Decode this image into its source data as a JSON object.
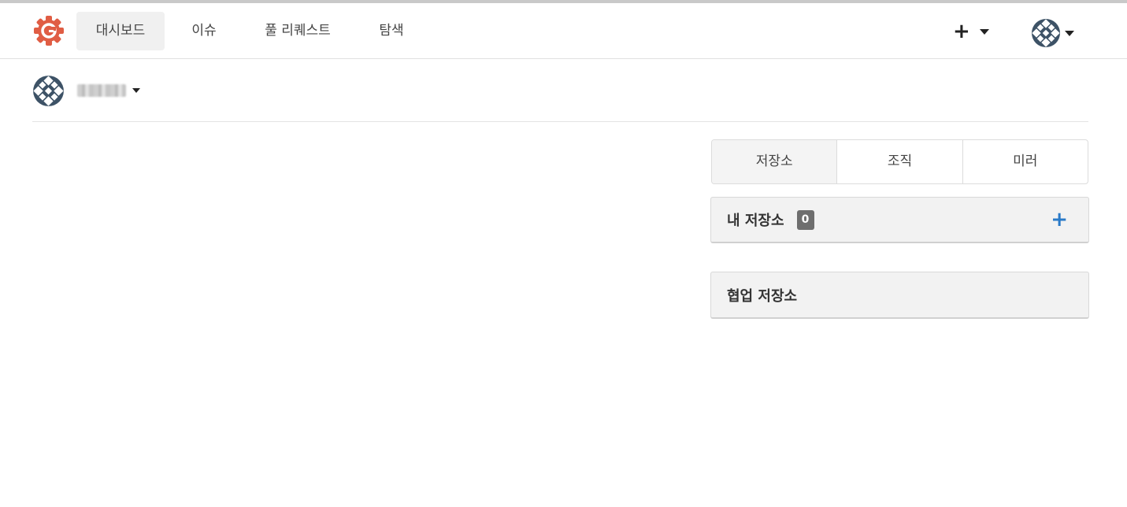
{
  "navbar": {
    "logo_icon": "gitea-gear-logo-icon",
    "brand_color": "#e05d44",
    "items": [
      {
        "label": "대시보드",
        "active": true
      },
      {
        "label": "이슈",
        "active": false
      },
      {
        "label": "풀 리퀘스트",
        "active": false
      },
      {
        "label": "탐색",
        "active": false
      }
    ],
    "create_label": "+",
    "user_avatar_icon": "avatar-icon"
  },
  "context": {
    "avatar_icon": "avatar-icon",
    "name": "user"
  },
  "tabs": [
    {
      "label": "저장소",
      "active": true
    },
    {
      "label": "조직",
      "active": false
    },
    {
      "label": "미러",
      "active": false
    }
  ],
  "my_repos": {
    "title": "내 저장소",
    "count": "0",
    "add_label": "+",
    "accent": "#2a7ac8"
  },
  "collab_repos": {
    "title": "협업 저장소"
  }
}
